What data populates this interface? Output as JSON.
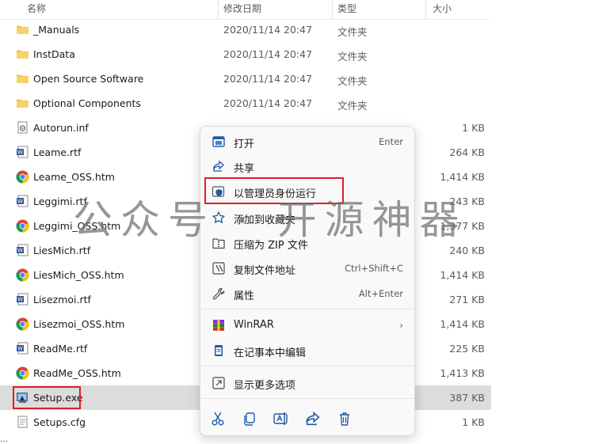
{
  "header": {
    "name": "名称",
    "date": "修改日期",
    "type": "类型",
    "size": "大小"
  },
  "files": [
    {
      "icon": "folder",
      "name": "_Manuals",
      "date": "2020/11/14 20:47",
      "type": "文件夹",
      "size": ""
    },
    {
      "icon": "folder",
      "name": "InstData",
      "date": "2020/11/14 20:47",
      "type": "文件夹",
      "size": ""
    },
    {
      "icon": "folder",
      "name": "Open Source Software",
      "date": "2020/11/14 20:47",
      "type": "文件夹",
      "size": ""
    },
    {
      "icon": "folder",
      "name": "Optional Components",
      "date": "2020/11/14 20:47",
      "type": "文件夹",
      "size": ""
    },
    {
      "icon": "inf",
      "name": "Autorun.inf",
      "date": "",
      "type": "",
      "size": "1 KB"
    },
    {
      "icon": "word",
      "name": "Leame.rtf",
      "date": "",
      "type": "",
      "size": "264 KB"
    },
    {
      "icon": "chrome",
      "name": "Leame_OSS.htm",
      "date": "",
      "type": "",
      "size": "1,414 KB"
    },
    {
      "icon": "word",
      "name": "Leggimi.rtf",
      "date": "",
      "type": "",
      "size": "243 KB"
    },
    {
      "icon": "chrome",
      "name": "Leggimi_OSS.htm",
      "date": "",
      "type": "",
      "size": "1,377 KB"
    },
    {
      "icon": "word",
      "name": "LiesMich.rtf",
      "date": "",
      "type": "",
      "size": "240 KB"
    },
    {
      "icon": "chrome",
      "name": "LiesMich_OSS.htm",
      "date": "",
      "type": "",
      "size": "1,414 KB"
    },
    {
      "icon": "word",
      "name": "Lisezmoi.rtf",
      "date": "",
      "type": "",
      "size": "271 KB"
    },
    {
      "icon": "chrome",
      "name": "Lisezmoi_OSS.htm",
      "date": "",
      "type": "",
      "size": "1,414 KB"
    },
    {
      "icon": "word",
      "name": "ReadMe.rtf",
      "date": "",
      "type": "",
      "size": "225 KB"
    },
    {
      "icon": "chrome",
      "name": "ReadMe_OSS.htm",
      "date": "",
      "type": "",
      "size": "1,413 KB"
    },
    {
      "icon": "setup",
      "name": "Setup.exe",
      "date": "",
      "type": "",
      "size": "387 KB"
    },
    {
      "icon": "cfg",
      "name": "Setups.cfg",
      "date": "",
      "type": "",
      "size": "1 KB"
    }
  ],
  "status": "...",
  "watermark": "公众号 · 开源神器",
  "menu": {
    "items": [
      {
        "icon": "open-icon",
        "label": "打开",
        "key": "Enter"
      },
      {
        "icon": "share-icon",
        "label": "共享",
        "key": ""
      },
      {
        "icon": "admin-shield-icon",
        "label": "以管理员身份运行",
        "key": ""
      },
      {
        "icon": "star-icon",
        "label": "添加到收藏夹",
        "key": ""
      },
      {
        "icon": "zip-icon",
        "label": "压缩为 ZIP 文件",
        "key": ""
      },
      {
        "icon": "copy-path-icon",
        "label": "复制文件地址",
        "key": "Ctrl+Shift+C"
      },
      {
        "icon": "wrench-icon",
        "label": "属性",
        "key": "Alt+Enter"
      },
      {
        "icon": "winrar-icon",
        "label": "WinRAR",
        "key": "›"
      },
      {
        "icon": "notepad-icon",
        "label": "在记事本中编辑",
        "key": ""
      },
      {
        "icon": "more-options-icon",
        "label": "显示更多选项",
        "key": ""
      }
    ],
    "quick_actions": [
      "cut-icon",
      "copy-icon",
      "rename-icon",
      "share-icon",
      "delete-icon"
    ]
  },
  "colors": {
    "accent": "#0f6cbd",
    "highlight": "#e01e25",
    "folder": "#f3c54b",
    "chrome_red": "#db4437",
    "chrome_yellow": "#f4c20d",
    "chrome_green": "#0f9d58",
    "chrome_blue": "#4285f4"
  }
}
